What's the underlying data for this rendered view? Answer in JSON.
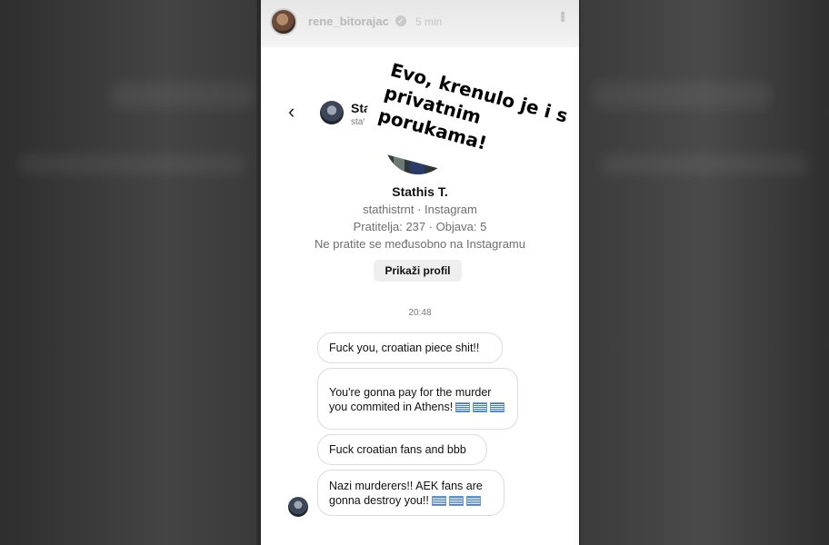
{
  "story": {
    "username": "rene_bitorajac",
    "time": "5 min",
    "annotation_lines": [
      "Evo, krenulo je i s",
      "privatnim",
      "porukama!"
    ]
  },
  "dm": {
    "name": "Stathis T.",
    "handle": "stathistrnt",
    "profile_name": "Stathis T.",
    "profile_sub": "stathistrnt · Instagram",
    "stats": "Pratitelja: 237 · Objava: 5",
    "mutual": "Ne pratite se međusobno na Instagramu",
    "view_profile": "Prikaži profil",
    "timestamp": "20:48",
    "messages": [
      {
        "text": "Fuck you, croatian piece shit!!",
        "flags": 0
      },
      {
        "text": "You're gonna pay for the murder you commited in Athens!",
        "flags": 3
      },
      {
        "text": "Fuck croatian fans and bbb",
        "flags": 0
      },
      {
        "text": "Nazi murderers!! AEK fans are gonna destroy you!!",
        "flags": 3
      }
    ]
  },
  "icons": {
    "back": "chevron-left-icon",
    "verified": "verified-badge-icon",
    "more": "more-vertical-icon",
    "flag": "greek-flag-emoji"
  }
}
